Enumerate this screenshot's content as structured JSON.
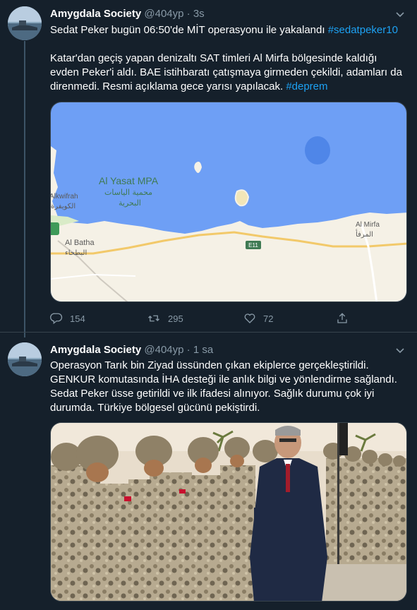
{
  "tweets": [
    {
      "author": "Amygdala Society",
      "handle": "@404yp",
      "dot": "·",
      "time": "3s",
      "line1_text": "Sedat Peker bugün 06:50'de MİT operasyonu ile yakalandı ",
      "line1_hashtag": "#sedatpeker10",
      "para_text": "Katar'dan geçiş yapan denizaltı SAT timleri Al Mirfa bölgesinde kaldığı evden Peker'i aldı. BAE istihbaratı çatışmaya girmeden çekildi, adamları da direnmedi. Resmi açıklama gece yarısı yapılacak. ",
      "para_hashtag": "#deprem",
      "map": {
        "label_mpa": "Al Yasat MPA",
        "label_mpa_ar1": "محمية الياسات",
        "label_mpa_ar2": "البحرية",
        "label_ruwais": "Alkwifrah",
        "label_ruwais_ar": "الكويفرة",
        "label_batha": "Al Batha",
        "label_batha_ar": "البطحاء",
        "label_mirfa": "Al Mirfa",
        "label_mirfa_ar": "المرفأ",
        "road_label": "E11",
        "sea_color": "#6e9ff5",
        "land_color": "#f5f1e6"
      },
      "stats": {
        "replies": "154",
        "retweets": "295",
        "likes": "72"
      }
    },
    {
      "author": "Amygdala Society",
      "handle": "@404yp",
      "dot": "·",
      "time": "1 sa",
      "para_text": "Operasyon Tarık bin Ziyad üssünden çıkan ekiplerce gerçekleştirildi. GENKUR komutasında İHA desteği ile anlık bilgi ve yönlendirme sağlandı. Sedat Peker üsse getirildi ve ilk ifadesi alınıyor. Sağlık durumu çok iyi durumda. Türkiye bölgesel gücünü pekiştirdi."
    }
  ],
  "colors": {
    "background": "#15202b",
    "text": "#ffffff",
    "secondary": "#8899a6",
    "link": "#1da1f2",
    "border": "#38444d"
  },
  "icons": [
    "reply-icon",
    "retweet-icon",
    "like-icon",
    "share-icon",
    "caret-down-icon"
  ]
}
